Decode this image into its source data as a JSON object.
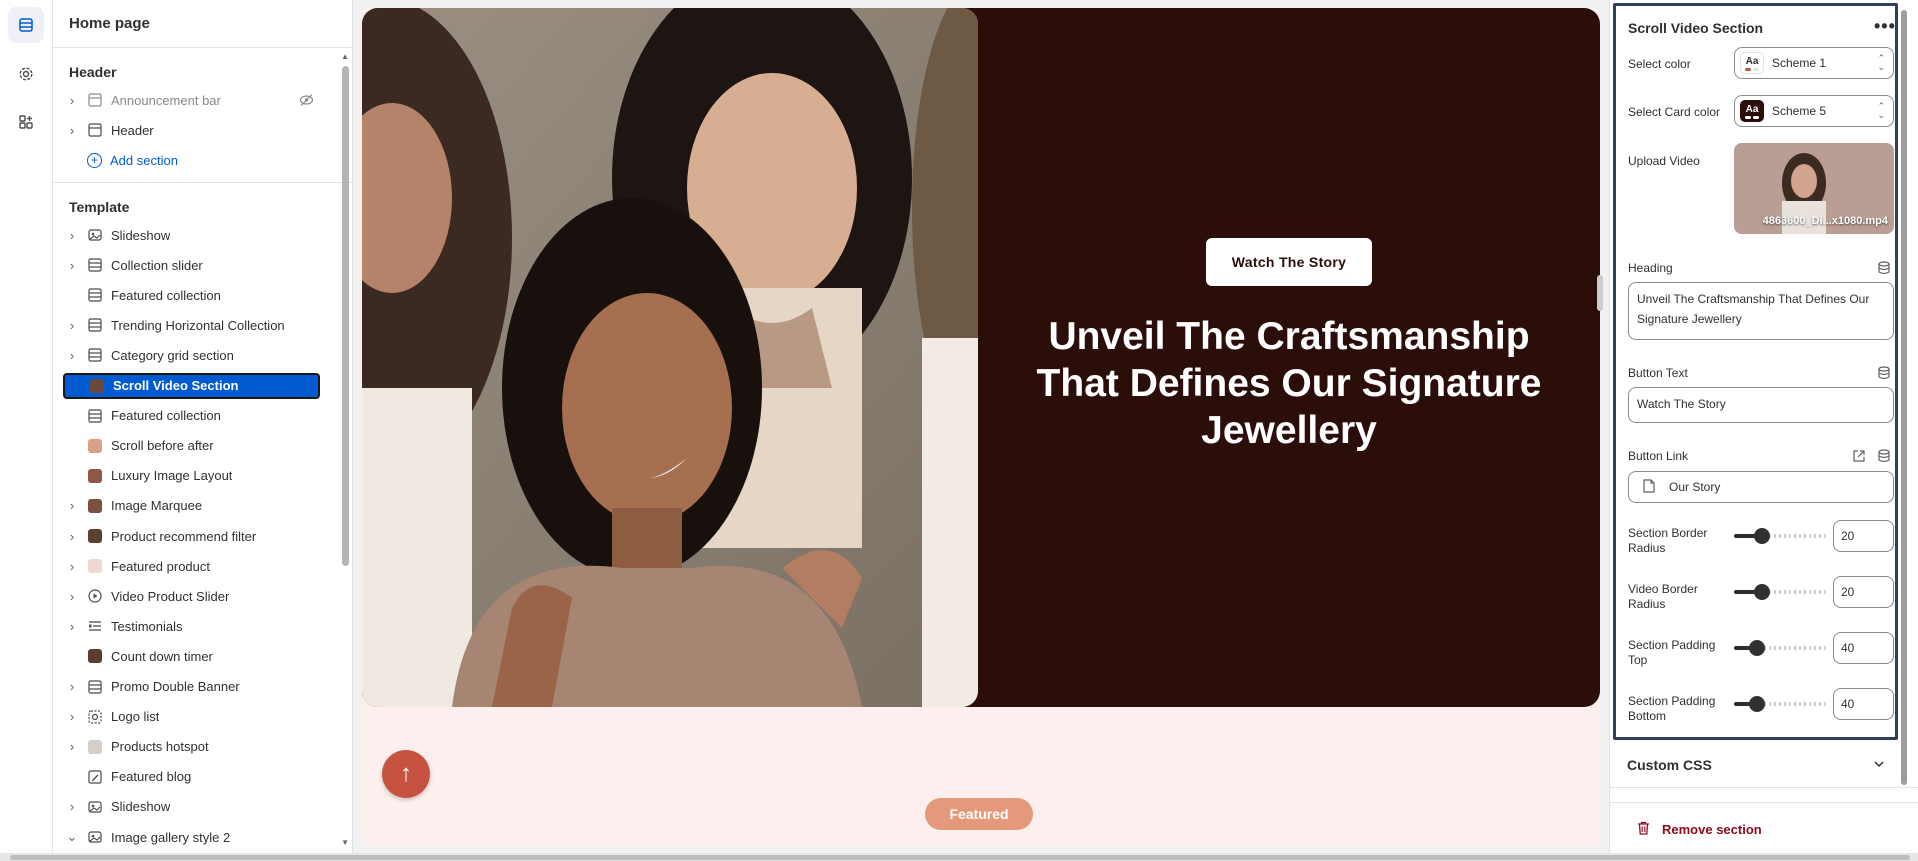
{
  "left_panel": {
    "title": "Home page",
    "header_group": "Header",
    "header_items": [
      {
        "label": "Announcement bar"
      },
      {
        "label": "Header"
      }
    ],
    "add_section": "Add section",
    "template_group": "Template",
    "template_items": [
      {
        "label": "Slideshow"
      },
      {
        "label": "Collection slider"
      },
      {
        "label": "Featured collection"
      },
      {
        "label": "Trending Horizontal Collection"
      },
      {
        "label": "Category grid section"
      },
      {
        "label": "Scroll Video Section"
      },
      {
        "label": "Featured collection"
      },
      {
        "label": "Scroll before after"
      },
      {
        "label": "Luxury Image Layout"
      },
      {
        "label": "Image Marquee"
      },
      {
        "label": "Product recommend filter"
      },
      {
        "label": "Featured product"
      },
      {
        "label": "Video Product Slider"
      },
      {
        "label": "Testimonials"
      },
      {
        "label": "Count down timer"
      },
      {
        "label": "Promo Double Banner"
      },
      {
        "label": "Logo list"
      },
      {
        "label": "Products hotspot"
      },
      {
        "label": "Featured blog"
      },
      {
        "label": "Slideshow"
      },
      {
        "label": "Image gallery style 2"
      }
    ]
  },
  "preview": {
    "button_label": "Watch The Story",
    "heading": "Unveil The Craftsmanship That Defines Our Signature Jewellery",
    "featured_label": "Featured",
    "up_arrow": "↑"
  },
  "settings": {
    "title": "Scroll Video Section",
    "more_icon": "•••",
    "select_color_label": "Select color",
    "select_color_value": "Scheme 1",
    "select_card_color_label": "Select Card color",
    "select_card_color_value": "Scheme 5",
    "swatch_text": "Aa",
    "upload_video_label": "Upload Video",
    "video_filename": "4863600_Di...x1080.mp4",
    "heading_label": "Heading",
    "heading_value": "Unveil The Craftsmanship That Defines Our Signature Jewellery",
    "button_text_label": "Button Text",
    "button_text_value": "Watch The Story",
    "button_link_label": "Button Link",
    "button_link_value": "Our Story",
    "sliders": [
      {
        "label": "Section Border Radius",
        "value": "20",
        "fraction": 0.3
      },
      {
        "label": "Video Border Radius",
        "value": "20",
        "fraction": 0.3
      },
      {
        "label": "Section Padding Top",
        "value": "40",
        "fraction": 0.25
      },
      {
        "label": "Section Padding Bottom",
        "value": "40",
        "fraction": 0.25
      }
    ],
    "custom_css_label": "Custom CSS",
    "remove_label": "Remove section"
  },
  "colors": {
    "accent_blue": "#005bd3",
    "hero_bg": "#2b0d09",
    "preview_bg": "#fcefed",
    "featured_pill": "#e49a7a",
    "up_button": "#c5533f",
    "danger": "#8e0b21"
  }
}
